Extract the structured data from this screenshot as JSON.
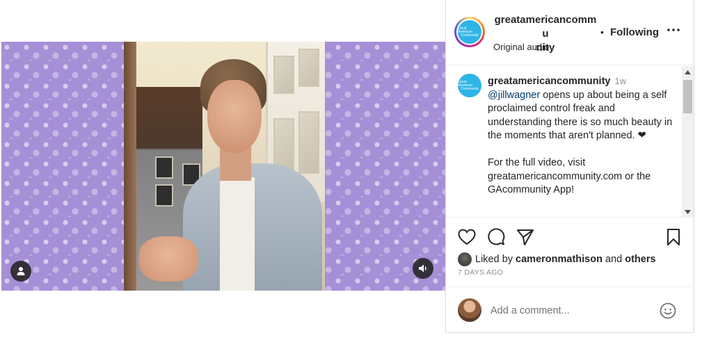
{
  "post": {
    "username_line1": "greatamericancommu",
    "username_line2": "nity",
    "separator": "•",
    "follow_label": "Following",
    "audio_label": "Original audio",
    "logo_text_top": "Great American",
    "logo_text_bottom": "Community"
  },
  "comments": {
    "author": "greatamericancommunity",
    "time": "1w",
    "mention": "@jillwagner",
    "text_part1": " opens up about being a self proclaimed control freak and understanding there is so much beauty in the moments that aren't planned. ❤",
    "text_part2": "For the full video, visit greatamericancommunity.com or the GAcommunity App!"
  },
  "engagement": {
    "liked_prefix": "Liked by",
    "liked_user": "cameronmathison",
    "liked_and": "and",
    "liked_others": "others",
    "date": "7 DAYS AGO"
  },
  "composer": {
    "placeholder": "Add a comment..."
  },
  "icons": {
    "user_tag": "user-icon",
    "sound": "speaker-icon",
    "more": "more-dots-icon",
    "like": "heart-icon",
    "comment": "comment-icon",
    "share": "send-icon",
    "save": "bookmark-icon",
    "emoji": "smiley-icon"
  },
  "colors": {
    "mention": "#00376b",
    "muted": "#8e8e8e",
    "brand_logo": "#2eb4e6",
    "background_pattern": "#a58fd6"
  }
}
